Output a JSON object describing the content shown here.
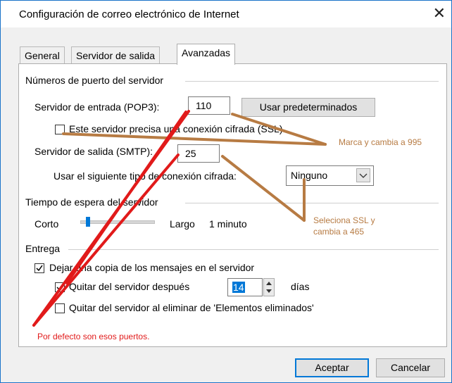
{
  "window": {
    "title": "Configuración de correo electrónico de Internet",
    "close_glyph": "✕"
  },
  "tabs": [
    {
      "label": "General",
      "active": false
    },
    {
      "label": "Servidor de salida",
      "active": false
    },
    {
      "label": "Avanzadas",
      "active": true
    }
  ],
  "ports": {
    "section_title": "Números de puerto del servidor",
    "incoming_label": "Servidor de entrada (POP3):",
    "incoming_value": "110",
    "defaults_button": "Usar predeterminados",
    "ssl_checkbox_label": "Este servidor precisa una conexión cifrada (SSL)",
    "ssl_checked": false,
    "outgoing_label": "Servidor de salida (SMTP):",
    "outgoing_value": "25",
    "encryption_label": "Usar el siguiente tipo de conexión cifrada:",
    "encryption_value": "Ninguno"
  },
  "timeout": {
    "section_title": "Tiempo de espera del servidor",
    "short_label": "Corto",
    "long_label": "Largo",
    "value_text": "1 minuto",
    "level": 0.0
  },
  "delivery": {
    "section_title": "Entrega",
    "leave_copy_label": "Dejar una copia de los mensajes en el servidor",
    "leave_copy_checked": true,
    "remove_after_label": "Quitar del servidor después",
    "remove_after_checked": true,
    "days_value": "14",
    "days_label": "días",
    "remove_deleted_label": "Quitar del servidor al eliminar de 'Elementos eliminados'",
    "remove_deleted_checked": false
  },
  "footer": {
    "ok_label": "Aceptar",
    "cancel_label": "Cancelar"
  },
  "annotations": {
    "ssl_note": "Marca y cambia a 995",
    "smtp_note_line1": "Seleciona SSL y",
    "smtp_note_line2": "cambia a 465",
    "defaults_note": "Por defecto son esos puertos.",
    "brown_color": "#b77b43",
    "red_color": "#e11a1a"
  },
  "colors": {
    "accent": "#0078d7",
    "window_border": "#1a73c9"
  }
}
